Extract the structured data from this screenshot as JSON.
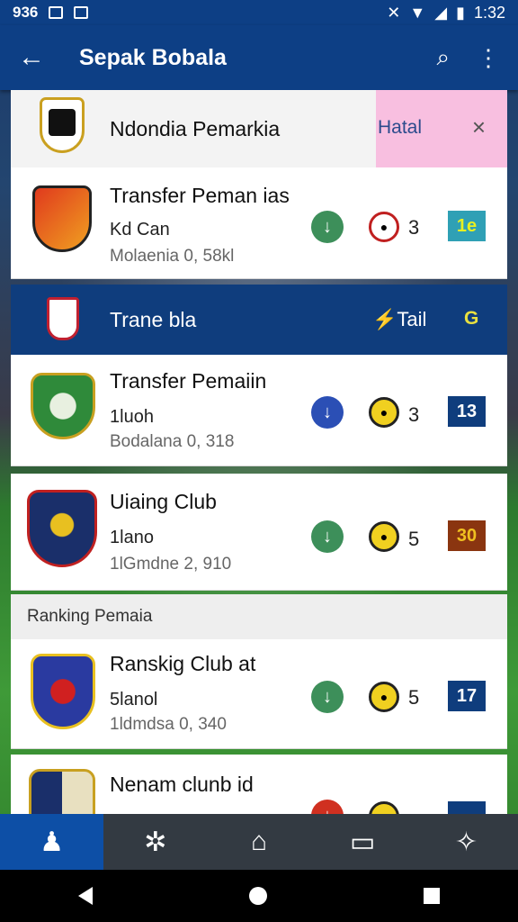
{
  "status_bar": {
    "left_text": "936",
    "time": "1:32"
  },
  "app_bar": {
    "title": "Sepak Bobala"
  },
  "top_row": {
    "name": "Ndondia Pemarkia",
    "action_label": "Hatal",
    "close_label": "×"
  },
  "cards": [
    {
      "name": "Transfer Peman ias",
      "sub1": "Kd Can",
      "sub2": "Molaenia 0, 58kl",
      "count": "3",
      "badge": "1e",
      "arrow_color": "#3d8f5a",
      "badge_color": "#2fa0b5",
      "logo_colors": [
        "#e03a1e",
        "#f0a020"
      ]
    },
    {
      "name": "Transfer Pemaiin",
      "sub1": "1luoh",
      "sub2": "Bodalana 0, 318",
      "count": "3",
      "badge": "13",
      "arrow_color": "#2b4fb5",
      "badge_color": "#0f3d7d",
      "logo_colors": [
        "#2f8a3a",
        "#e8d040"
      ]
    },
    {
      "name": "Uiaing Club",
      "sub1": "1lano",
      "sub2": "1lGmdne 2, 910",
      "count": "5",
      "badge": "30",
      "arrow_color": "#3d8f5a",
      "badge_color": "#8a3510",
      "logo_colors": [
        "#1a2f6a",
        "#e8c020"
      ]
    },
    {
      "name": "Ranskig Club at",
      "sub1": "5lanol",
      "sub2": "1ldmdsa 0, 340",
      "count": "5",
      "badge": "17",
      "arrow_color": "#3d8f5a",
      "badge_color": "#0f3d7d",
      "logo_colors": [
        "#2a3aa0",
        "#d02020"
      ]
    },
    {
      "name": "Nenam clunb id",
      "sub1": "",
      "sub2": "",
      "count": "",
      "badge": "",
      "arrow_color": "#d03020",
      "badge_color": "#0f3d7d",
      "logo_colors": [
        "#1a2f6a",
        "#e8e0c0"
      ]
    }
  ],
  "band": {
    "name": "Trane bla",
    "action": "Tail",
    "value": "G"
  },
  "section": {
    "label": "Ranking Pemaia"
  },
  "bottom_nav": [
    "players-icon",
    "ball-icon",
    "home-icon",
    "message-icon",
    "user-icon"
  ]
}
